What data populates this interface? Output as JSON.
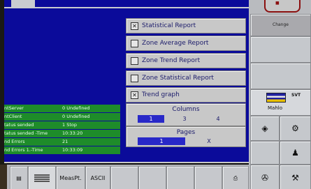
{
  "options": [
    {
      "label": "Statistical Report",
      "checked": true
    },
    {
      "label": "Zone Average Report",
      "checked": false
    },
    {
      "label": "Zone Trend Report",
      "checked": false
    },
    {
      "label": "Zone Statistical Report",
      "checked": false
    },
    {
      "label": "Trend graph",
      "checked": true
    }
  ],
  "columns": {
    "title": "Columns",
    "choices": [
      "1",
      "3",
      "4"
    ],
    "selected": "1"
  },
  "pages": {
    "title": "Pages",
    "choices": [
      "1",
      "X"
    ],
    "selected": "1"
  },
  "status_rows": [
    {
      "key": "ntServer",
      "value": "0 Undefined"
    },
    {
      "key": "ntClient",
      "value": "0 Undefined"
    },
    {
      "key": "tatus sended",
      "value": "1 Stop"
    },
    {
      "key": "tatus sended -Time",
      "value": "10:33:20"
    },
    {
      "key": "nd Errors",
      "value": "21"
    },
    {
      "key": "nd Errors 1.-Time",
      "value": "10:33:09"
    }
  ],
  "right_panel": {
    "change_label": "Change",
    "logo_top": "SVT",
    "logo_bottom": "Mahlo"
  },
  "toolbar": {
    "measpt_label": "MeasPt.",
    "ascii_label": "ASCII"
  }
}
